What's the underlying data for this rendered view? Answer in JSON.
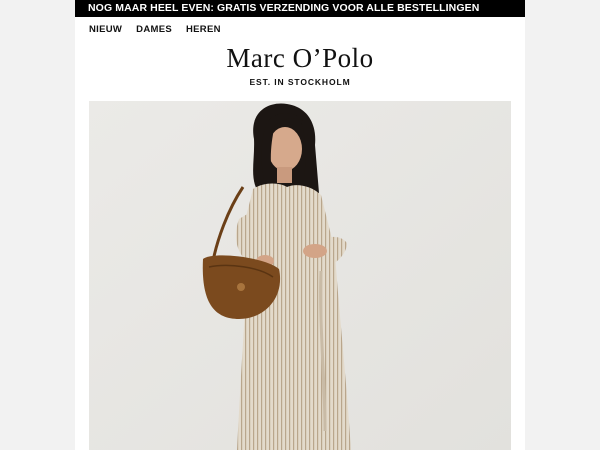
{
  "promo": {
    "text": "NOG MAAR HEEL EVEN: GRATIS VERZENDING VOOR ALLE BESTELLINGEN"
  },
  "nav": {
    "items": [
      "NIEUW",
      "DAMES",
      "HEREN"
    ]
  },
  "brand": {
    "logo": "Marc O’Polo",
    "tagline": "EST. IN STOCKHOLM"
  },
  "hero": {
    "image": "model-in-striped-shirt-dress-with-brown-bag-icon"
  },
  "colors": {
    "promo_bg": "#000000",
    "hero_bg": "#e7e6e3",
    "bag": "#7b4a1e",
    "dress": "#ddd3c3",
    "hair": "#1c1613"
  }
}
